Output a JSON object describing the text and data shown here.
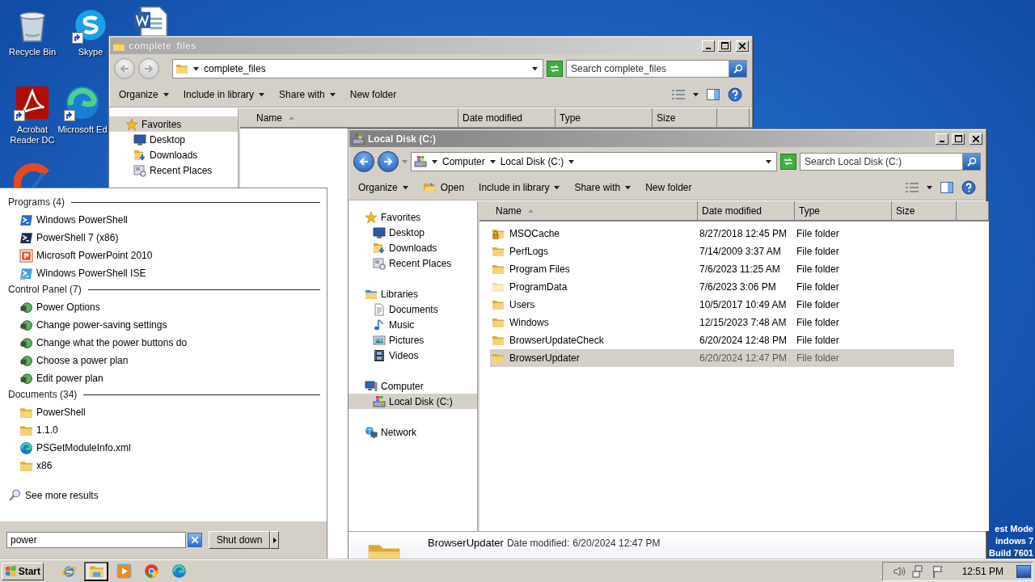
{
  "desktop": {
    "icons": [
      {
        "kind": "recycle-bin",
        "label": "Recycle Bin"
      },
      {
        "kind": "skype",
        "label": "Skype",
        "shortcut": true
      },
      {
        "kind": "word"
      },
      {
        "kind": "acrobat",
        "label": "Acrobat Reader DC",
        "shortcut": true
      },
      {
        "kind": "edge",
        "label": "Microsoft Ed",
        "shortcut": true
      },
      {
        "kind": "ccleaner"
      }
    ],
    "build_info": [
      "est Mode",
      "indows 7",
      "Build 7601"
    ]
  },
  "windows": [
    {
      "title": "complete_files",
      "active": false,
      "nav_enabled": false,
      "kind": "folder",
      "address": [
        "complete_files"
      ],
      "trailing_caret": false,
      "search_placeholder": "Search complete_files",
      "toolbar": [
        {
          "label": "Organize",
          "menu": true,
          "icon": false
        },
        {
          "label": "Include in library",
          "menu": true,
          "icon": false
        },
        {
          "label": "Share with",
          "menu": true,
          "icon": false
        },
        {
          "label": "New folder",
          "menu": false,
          "icon": false
        }
      ],
      "nav": [
        {
          "label": "Favorites",
          "kind": "favorites",
          "selected": true,
          "children": [
            {
              "label": "Desktop",
              "kind": "desktop",
              "selected": false
            },
            {
              "label": "Downloads",
              "kind": "downloads",
              "selected": false
            },
            {
              "label": "Recent Places",
              "kind": "recent",
              "selected": false
            }
          ]
        }
      ],
      "columns": [
        "Name",
        "Date modified",
        "Type",
        "Size"
      ]
    },
    {
      "title": "Local Disk (C:)",
      "active": true,
      "nav_enabled": true,
      "kind": "computer",
      "address": [
        "Computer",
        "Local Disk (C:)"
      ],
      "trailing_caret": true,
      "search_placeholder": "Search Local Disk (C:)",
      "toolbar": [
        {
          "label": "Organize",
          "menu": true,
          "icon": false
        },
        {
          "label": "Open",
          "menu": false,
          "icon": true
        },
        {
          "label": "Include in library",
          "menu": true,
          "icon": false
        },
        {
          "label": "Share with",
          "menu": true,
          "icon": false
        },
        {
          "label": "New folder",
          "menu": false,
          "icon": false
        }
      ],
      "nav": [
        {
          "label": "Favorites",
          "kind": "favorites",
          "selected": false,
          "children": [
            {
              "label": "Desktop",
              "kind": "desktop",
              "selected": false
            },
            {
              "label": "Downloads",
              "kind": "downloads",
              "selected": false
            },
            {
              "label": "Recent Places",
              "kind": "recent",
              "selected": false
            }
          ]
        },
        {
          "label": "Libraries",
          "kind": "libraries",
          "selected": false,
          "children": [
            {
              "label": "Documents",
              "kind": "documents",
              "selected": false
            },
            {
              "label": "Music",
              "kind": "music",
              "selected": false
            },
            {
              "label": "Pictures",
              "kind": "pictures",
              "selected": false
            },
            {
              "label": "Videos",
              "kind": "videos",
              "selected": false
            }
          ]
        },
        {
          "label": "Computer",
          "kind": "computer",
          "selected": false,
          "children": [
            {
              "label": "Local Disk (C:)",
              "kind": "drive",
              "selected": true
            }
          ]
        },
        {
          "label": "Network",
          "kind": "network",
          "selected": false
        }
      ],
      "columns": [
        "Name",
        "Date modified",
        "Type",
        "Size"
      ],
      "rows": [
        {
          "name": "MSOCache",
          "date": "8/27/2018 12:45 PM",
          "type": "File folder",
          "kind": "folder-locked",
          "selected": false
        },
        {
          "name": "PerfLogs",
          "date": "7/14/2009 3:37 AM",
          "type": "File folder",
          "kind": "folder",
          "selected": false
        },
        {
          "name": "Program Files",
          "date": "7/6/2023 11:25 AM",
          "type": "File folder",
          "kind": "folder",
          "selected": false
        },
        {
          "name": "ProgramData",
          "date": "7/6/2023 3:06 PM",
          "type": "File folder",
          "kind": "folder-hidden",
          "selected": false
        },
        {
          "name": "Users",
          "date": "10/5/2017 10:49 AM",
          "type": "File folder",
          "kind": "folder",
          "selected": false
        },
        {
          "name": "Windows",
          "date": "12/15/2023 7:48 AM",
          "type": "File folder",
          "kind": "folder",
          "selected": false
        },
        {
          "name": "BrowserUpdateCheck",
          "date": "6/20/2024 12:48 PM",
          "type": "File folder",
          "kind": "folder",
          "selected": false
        },
        {
          "name": "BrowserUpdater",
          "date": "6/20/2024 12:47 PM",
          "type": "File folder",
          "kind": "folder",
          "selected": true
        }
      ],
      "details": {
        "name": "BrowserUpdater",
        "label": "Date modified:",
        "value": "6/20/2024 12:47 PM"
      }
    }
  ],
  "start_menu": {
    "groups": [
      {
        "title": "Programs (4)",
        "items": [
          {
            "label": "Windows PowerShell",
            "kind": "powershell"
          },
          {
            "label": "PowerShell 7 (x86)",
            "kind": "powershell-dark"
          },
          {
            "label": "Microsoft PowerPoint 2010",
            "kind": "powerpoint"
          },
          {
            "label": "Windows PowerShell ISE",
            "kind": "powershell-ise"
          }
        ]
      },
      {
        "title": "Control Panel (7)",
        "items": [
          {
            "label": "Power Options",
            "kind": "power"
          },
          {
            "label": "Change power-saving settings",
            "kind": "power"
          },
          {
            "label": "Change what the power buttons do",
            "kind": "power"
          },
          {
            "label": "Choose a power plan",
            "kind": "power"
          },
          {
            "label": "Edit power plan",
            "kind": "power"
          }
        ]
      },
      {
        "title": "Documents (34)",
        "items": [
          {
            "label": "PowerShell",
            "kind": "folder"
          },
          {
            "label": "1.1.0",
            "kind": "folder"
          },
          {
            "label": "PSGetModuleInfo.xml",
            "kind": "edge"
          },
          {
            "label": "x86",
            "kind": "folder"
          }
        ]
      }
    ],
    "see_more": "See more results",
    "search_value": "power",
    "shutdown": "Shut down"
  },
  "taskbar": {
    "start": "Start",
    "apps": [
      {
        "kind": "ie",
        "selected": false
      },
      {
        "kind": "explorer",
        "selected": true
      },
      {
        "kind": "media",
        "selected": false
      },
      {
        "kind": "chrome",
        "selected": false
      },
      {
        "kind": "edge",
        "selected": false
      }
    ],
    "clock": "12:51 PM"
  }
}
